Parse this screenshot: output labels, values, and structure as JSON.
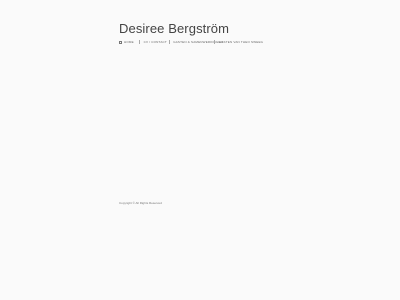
{
  "header": {
    "site_title": "Desiree Bergström"
  },
  "nav": {
    "items": [
      {
        "label": "HOME"
      },
      {
        "label": "CV / CONTACT"
      },
      {
        "label": "GASTEN & SAMENWERKINGEN"
      },
      {
        "label": "GASTEN VAN THEO SWEEG"
      }
    ]
  },
  "footer": {
    "copyright": "Copyright © All Rights Reserved"
  }
}
